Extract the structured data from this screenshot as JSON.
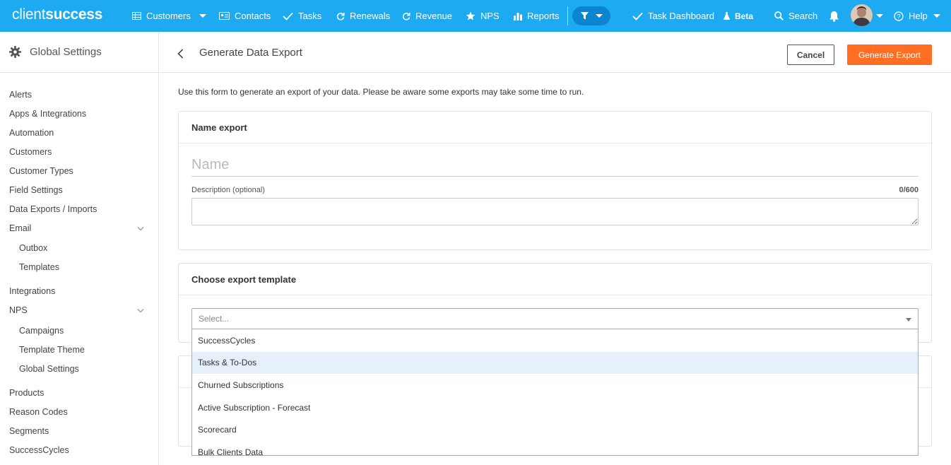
{
  "brand": {
    "thin": "client",
    "bold": "success"
  },
  "nav": {
    "customers": "Customers",
    "contacts": "Contacts",
    "tasks": "Tasks",
    "renewals": "Renewals",
    "revenue": "Revenue",
    "nps": "NPS",
    "reports": "Reports",
    "task_dashboard": "Task Dashboard",
    "beta": "Beta",
    "search": "Search",
    "help": "Help"
  },
  "sidebar": {
    "title": "Global Settings",
    "items": [
      "Alerts",
      "Apps & Integrations",
      "Automation",
      "Customers",
      "Customer Types",
      "Field Settings",
      "Data Exports / Imports",
      "Email",
      "Outbox",
      "Templates",
      "Integrations",
      "NPS",
      "Campaigns",
      "Template Theme",
      "Global Settings",
      "Products",
      "Reason Codes",
      "Segments",
      "SuccessCycles"
    ]
  },
  "page": {
    "title": "Generate Data Export",
    "cancel": "Cancel",
    "generate": "Generate Export",
    "intro": "Use this form to generate an export of your data. Please be aware some exports may take some time to run."
  },
  "name_panel": {
    "heading": "Name export",
    "name_placeholder": "Name",
    "description_label": "Description (optional)",
    "char_count": "0/600"
  },
  "template_panel": {
    "heading": "Choose export template",
    "select_placeholder": "Select...",
    "options": [
      "SuccessCycles",
      "Tasks & To-Dos",
      "Churned Subscriptions",
      "Active Subscription - Forecast",
      "Scorecard",
      "Bulk Clients Data"
    ],
    "highlighted": "Tasks & To-Dos"
  },
  "colors": {
    "nav_bg": "#1eaaf1",
    "accent_orange": "#ff6e23",
    "highlight": "#e6f0fb"
  }
}
